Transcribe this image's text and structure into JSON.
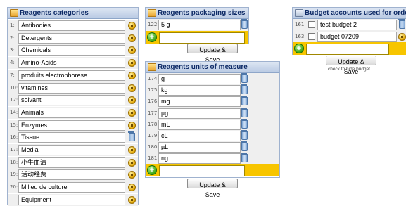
{
  "categories": {
    "title": "Reagents categories",
    "items": [
      {
        "index": "1:",
        "value": "Antibodies",
        "action_icon": "lock-icon"
      },
      {
        "index": "2:",
        "value": "Detergents",
        "action_icon": "lock-icon"
      },
      {
        "index": "3:",
        "value": "Chemicals",
        "action_icon": "lock-icon"
      },
      {
        "index": "4:",
        "value": "Amino-Acids",
        "action_icon": "lock-icon"
      },
      {
        "index": "7:",
        "value": "produits electrophorese",
        "action_icon": "lock-icon"
      },
      {
        "index": "10:",
        "value": "vitamines",
        "action_icon": "lock-icon"
      },
      {
        "index": "12:",
        "value": "solvant",
        "action_icon": "lock-icon"
      },
      {
        "index": "14:",
        "value": "Animals",
        "action_icon": "lock-icon"
      },
      {
        "index": "15:",
        "value": "Enzymes",
        "action_icon": "lock-icon"
      },
      {
        "index": "16:",
        "value": "Tissue",
        "action_icon": "trash-icon"
      },
      {
        "index": "17:",
        "value": "Media",
        "action_icon": "lock-icon"
      },
      {
        "index": "18:",
        "value": "小牛血清",
        "action_icon": "lock-icon"
      },
      {
        "index": "19:",
        "value": "活动经费",
        "action_icon": "lock-icon"
      },
      {
        "index": "20:",
        "value": "Milieu de culture",
        "action_icon": "lock-icon"
      },
      {
        "index": "",
        "value": "Equipment",
        "action_icon": "lock-icon"
      }
    ]
  },
  "packaging": {
    "title": "Reagents packaging sizes",
    "items": [
      {
        "index": "122:",
        "value": "5 g",
        "action_icon": "trash-icon"
      }
    ],
    "new_value": "",
    "button_label": "Update & Save"
  },
  "units": {
    "title": "Reagents units of measure",
    "items": [
      {
        "index": "174:",
        "value": "g",
        "action_icon": "trash-icon"
      },
      {
        "index": "175:",
        "value": "kg",
        "action_icon": "trash-icon"
      },
      {
        "index": "176:",
        "value": "mg",
        "action_icon": "trash-icon"
      },
      {
        "index": "177:",
        "value": "µg",
        "action_icon": "trash-icon"
      },
      {
        "index": "178:",
        "value": "mL",
        "action_icon": "trash-icon"
      },
      {
        "index": "179:",
        "value": "cL",
        "action_icon": "trash-icon"
      },
      {
        "index": "180:",
        "value": "µL",
        "action_icon": "trash-icon"
      },
      {
        "index": "181:",
        "value": "ng",
        "action_icon": "trash-icon"
      }
    ],
    "new_value": "",
    "button_label": "Update & Save"
  },
  "budget": {
    "title": "Budget accounts used for ordering",
    "items": [
      {
        "index": "161:",
        "value": "test budget 2",
        "checked": false,
        "action_icon": "trash-icon"
      },
      {
        "index": "163:",
        "value": "budget 07209",
        "checked": false,
        "action_icon": "lock-icon"
      }
    ],
    "new_value": "",
    "button_label": "Update & Save",
    "hint": "check to hide budget"
  },
  "colors": {
    "header_text": "#0d2a66",
    "add_row_bg": "#f7c500",
    "add_button": "#39a514",
    "row_bg": "#efefef"
  }
}
